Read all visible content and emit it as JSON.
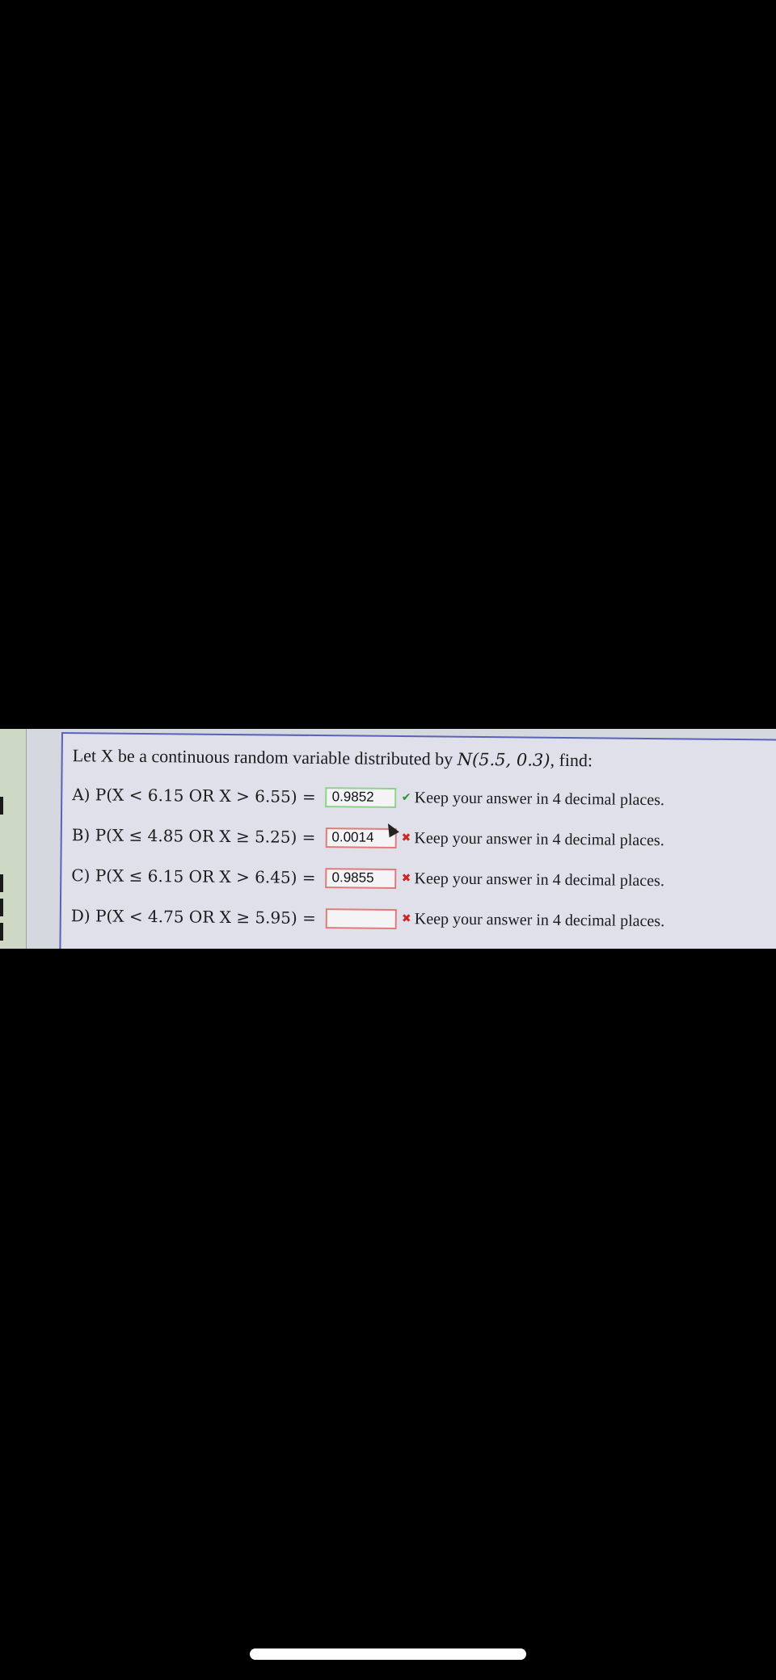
{
  "question": {
    "intro": "Let X be a continuous random variable distributed by",
    "distribution": "N(5.5, 0.3)",
    "suffix": ", find:"
  },
  "parts": [
    {
      "label": "A) P(X < 6.15 OR X > 6.55) =",
      "answer": "0.9852",
      "status": "correct",
      "hint": "Keep your answer in 4 decimal places."
    },
    {
      "label": "B) P(X ≤ 4.85 OR X ≥ 5.25) =",
      "answer": "0.0014",
      "status": "wrong",
      "hint": "Keep your answer in 4 decimal places."
    },
    {
      "label": "C) P(X ≤ 6.15 OR X > 6.45) =",
      "answer": "0.9855",
      "status": "wrong",
      "hint": "Keep your answer in 4 decimal places."
    },
    {
      "label": "D) P(X < 4.75 OR X ≥ 5.95) =",
      "answer": "",
      "status": "wrong",
      "hint": "Keep your answer in 4 decimal places."
    }
  ],
  "icons": {
    "correct": "check-icon",
    "wrong": "cross-icon"
  },
  "colors": {
    "correct_border": "#8fd08a",
    "wrong_border": "#e07a7a",
    "panel_border": "#5a62b8"
  }
}
